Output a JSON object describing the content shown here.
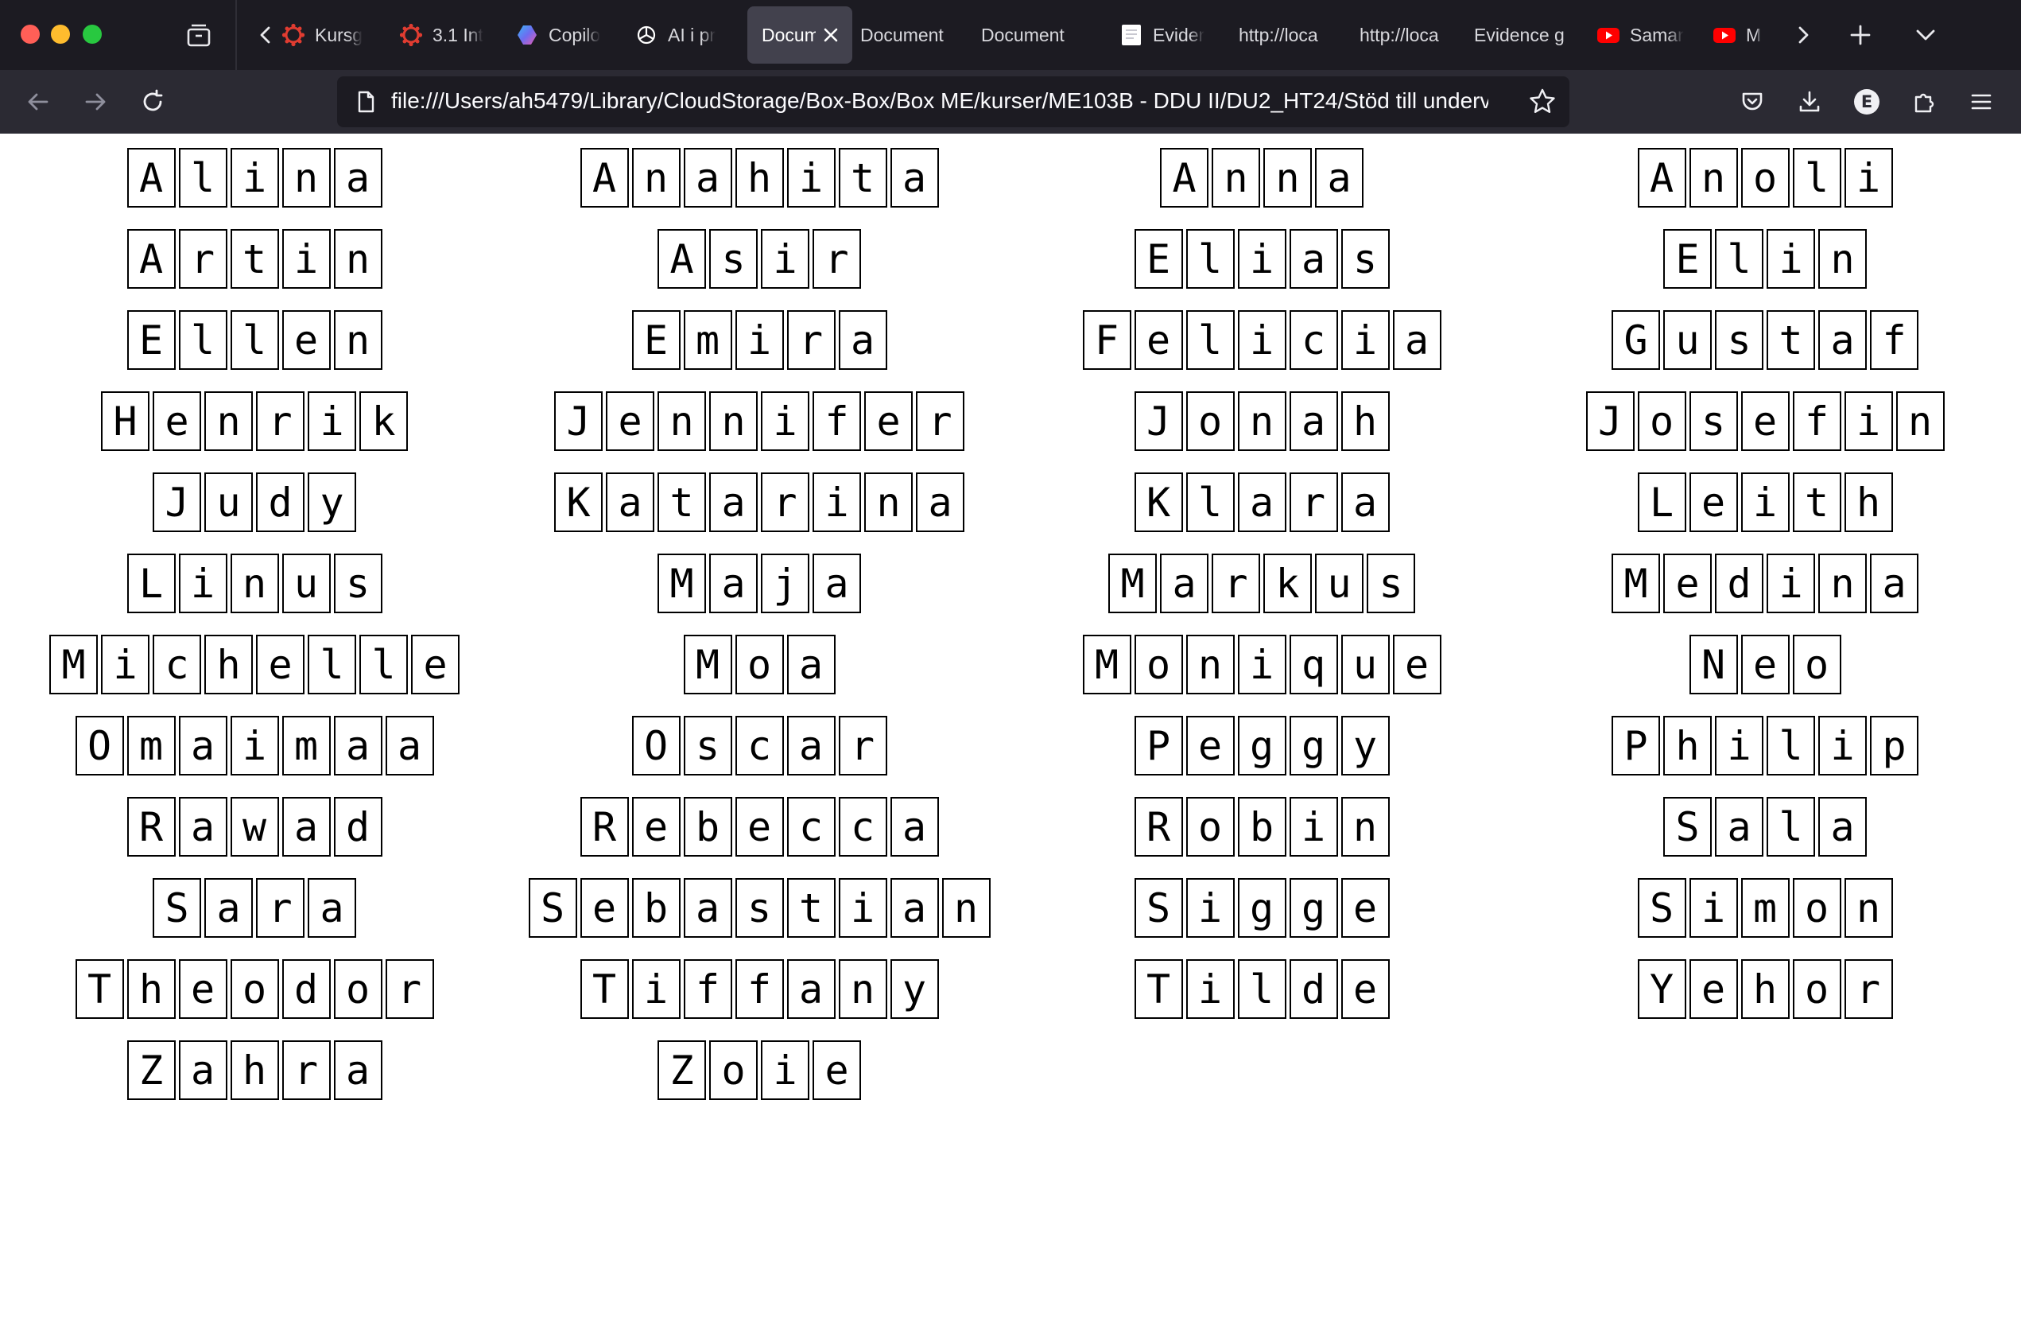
{
  "browser": {
    "tabs": [
      {
        "label": "Kursg",
        "icon": "gear-icon",
        "icon_color": "#e03c31",
        "active": false
      },
      {
        "label": "3.1 Int",
        "icon": "gear-icon",
        "icon_color": "#e03c31",
        "active": false
      },
      {
        "label": "Copilo",
        "icon": "copilot-icon",
        "icon_color": "#6e6cf0",
        "active": false
      },
      {
        "label": "AI i pr",
        "icon": "openai-icon",
        "icon_color": "#ffffff",
        "active": false
      },
      {
        "label": "Docum",
        "icon": "",
        "icon_color": "",
        "active": true
      },
      {
        "label": "Document",
        "icon": "",
        "icon_color": "",
        "active": false
      },
      {
        "label": "Document",
        "icon": "",
        "icon_color": "",
        "active": false
      },
      {
        "label": "Evider",
        "icon": "file-icon",
        "icon_color": "#ffffff",
        "active": false
      },
      {
        "label": "http://loca",
        "icon": "",
        "icon_color": "",
        "active": false
      },
      {
        "label": "http://loca",
        "icon": "",
        "icon_color": "",
        "active": false
      },
      {
        "label": "Evidence g",
        "icon": "",
        "icon_color": "",
        "active": false
      },
      {
        "label": "Samar",
        "icon": "youtube-icon",
        "icon_color": "#ff0000",
        "active": false
      },
      {
        "label": "M",
        "icon": "youtube-icon",
        "icon_color": "#ff0000",
        "active": false
      }
    ],
    "url": "file:///Users/ah5479/Library/CloudStorage/Box-Box/Box ME/kurser/ME103B - DDU II/DU2_HT24/Stöd till undervis",
    "profile_initial": "E"
  },
  "columns": [
    [
      "Alina",
      "Artin",
      "Ellen",
      "Henrik",
      "Judy",
      "Linus",
      "Michelle",
      "Omaimaa",
      "Rawad",
      "Sara",
      "Theodor",
      "Zahra"
    ],
    [
      "Anahita",
      "Asir",
      "Emira",
      "Jennifer",
      "Katarina",
      "Maja",
      "Moa",
      "Oscar",
      "Rebecca",
      "Sebastian",
      "Tiffany",
      "Zoie"
    ],
    [
      "Anna",
      "Elias",
      "Felicia",
      "Jonah",
      "Klara",
      "Markus",
      "Monique",
      "Peggy",
      "Robin",
      "Sigge",
      "Tilde"
    ],
    [
      "Anoli",
      "Elin",
      "Gustaf",
      "Josefin",
      "Leith",
      "Medina",
      "Neo",
      "Philip",
      "Sala",
      "Simon",
      "Yehor"
    ]
  ]
}
